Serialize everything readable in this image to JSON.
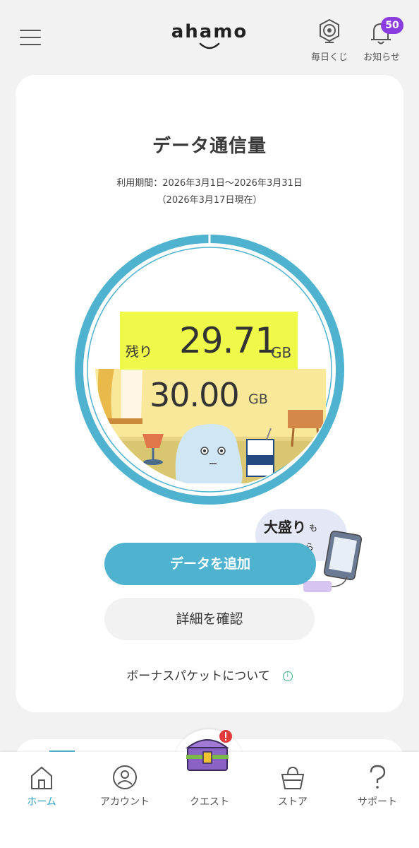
{
  "header": {
    "menu_icon": "hamburger-menu-icon",
    "logo": "ahamo",
    "lottery_label": "毎日くじ",
    "lottery_icon": "lottery-icon",
    "notice_label": "お知らせ",
    "notice_icon": "bell-icon",
    "notice_count": "50"
  },
  "data_card": {
    "title": "データ通信量",
    "period": "利用期間：2026年3月1日〜2026年3月31日",
    "as_of": "（2026年3月17日現在）",
    "remaining_label": "残り",
    "remaining_value": "29.71",
    "remaining_unit": "GB",
    "total_value": "30.00",
    "total_unit": "GB",
    "remaining_fraction": 0.99,
    "promo": {
      "line1": "大盛り",
      "line1_suffix": "も",
      "line2": "コチラから"
    },
    "add_data_button": "データを追加",
    "detail_button": "詳細を確認",
    "bonus_link": "ボーナスパケットについて",
    "bonus_info_icon": "info-icon",
    "bonus_info_glyph": "i"
  },
  "bottom_nav": {
    "items": [
      {
        "label": "ホーム",
        "icon": "home-icon",
        "active": true
      },
      {
        "label": "アカウント",
        "icon": "account-icon",
        "active": false
      },
      {
        "label": "クエスト",
        "icon": "treasure-chest-icon",
        "active": false
      },
      {
        "label": "ストア",
        "icon": "shopping-bag-icon",
        "active": false
      },
      {
        "label": "サポート",
        "icon": "question-icon",
        "active": false
      }
    ]
  },
  "colors": {
    "accent": "#4fb3cf",
    "active_nav": "#2e9fc4",
    "remaining_highlight": "#eef94a",
    "badge": "#8a3ce0"
  }
}
